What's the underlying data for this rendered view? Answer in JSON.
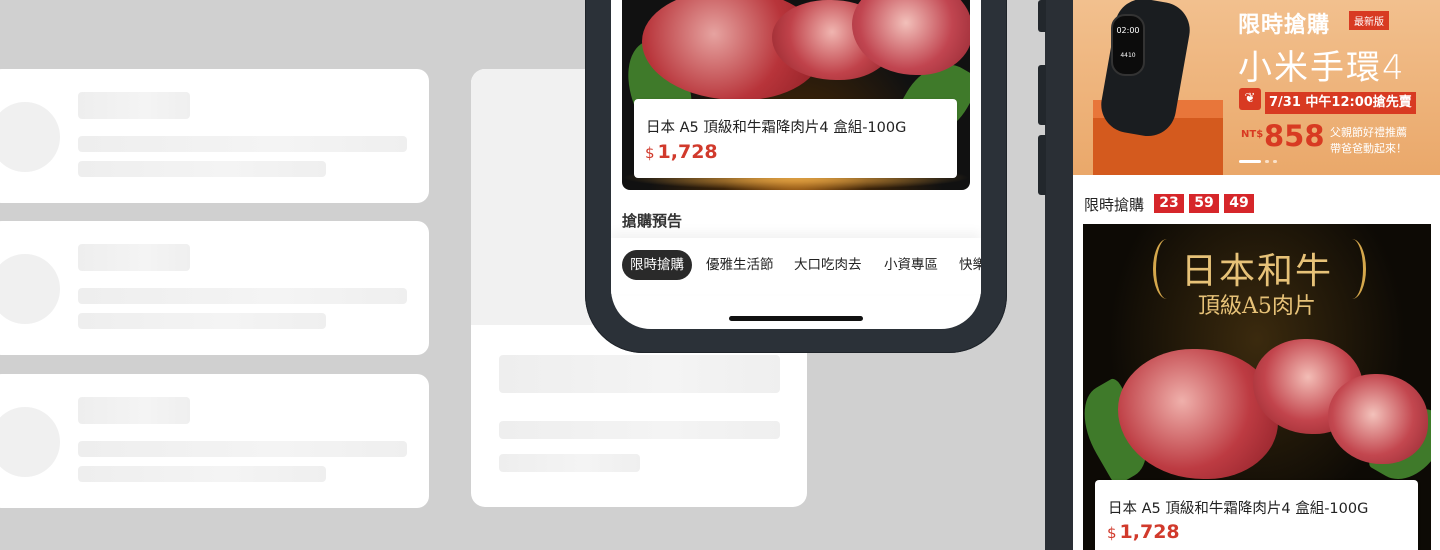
{
  "center_phone": {
    "product": {
      "name": "日本 A5 頂級和牛霜降肉片4 盒組-100G",
      "currency": "$",
      "price": "1,728"
    },
    "section_title": "搶購預告",
    "tabs": [
      {
        "label": "限時搶購",
        "active": true
      },
      {
        "label": "優雅生活節",
        "active": false
      },
      {
        "label": "大口吃肉去",
        "active": false
      },
      {
        "label": "小資專區",
        "active": false
      },
      {
        "label": "快樂",
        "active": false
      }
    ]
  },
  "right_phone": {
    "banner": {
      "headline": "限時搶購",
      "badge": "最新版",
      "product": "小米手環4",
      "date_text": "7/31 中午12:00搶先賣",
      "price_prefix": "NT$",
      "price": "858",
      "tagline_1": "父親節好禮推薦",
      "tagline_2": "帶爸爸動起來！",
      "band_time": "02:00",
      "band_sub": "4410"
    },
    "flash_sale": {
      "label": "限時搶購",
      "countdown": [
        "23",
        "59",
        "49"
      ]
    },
    "hero": {
      "title": "日本和牛",
      "subtitle": "頂級A5肉片"
    },
    "product": {
      "name": "日本 A5 頂級和牛霜降肉片4 盒組-100G",
      "currency": "$",
      "price": "1,728"
    }
  },
  "colors": {
    "accent_red": "#d13a2c",
    "countdown_red": "#d6262a",
    "banner_orange": "#e8702a",
    "skeleton_bg": "#d0d0d0"
  }
}
